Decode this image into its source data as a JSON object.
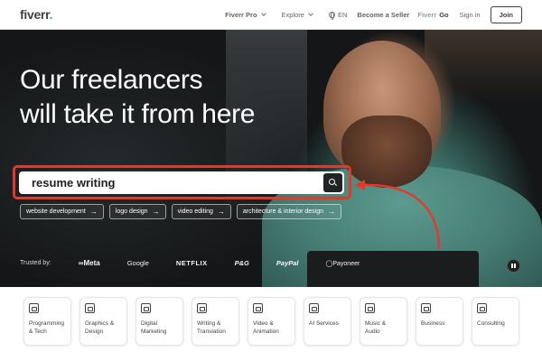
{
  "header": {
    "logo": "fiverr",
    "logo_dot": ".",
    "nav": {
      "fiverr_pro": "Fiverr Pro",
      "explore": "Explore",
      "language": "EN",
      "become_seller": "Become a Seller",
      "fiverr_go_prefix": "Fiverr",
      "fiverr_go_suffix": "Go",
      "sign_in": "Sign in",
      "join": "Join"
    }
  },
  "hero": {
    "headline_line1": "Our freelancers",
    "headline_line2": "will take it from here",
    "search": {
      "value": "resume writing",
      "icon": "search-icon"
    },
    "annotation_color": "#e03a2c",
    "chips": [
      {
        "label": "website development",
        "arrow": "→"
      },
      {
        "label": "logo design",
        "arrow": "→"
      },
      {
        "label": "video editing",
        "arrow": "→"
      },
      {
        "label": "architecture & interior design",
        "arrow": "→"
      }
    ],
    "trusted": {
      "label": "Trusted by:",
      "brands": [
        "∞Meta",
        "Google",
        "NETFLIX",
        "P&G",
        "PayPal",
        "◯Payoneer"
      ]
    },
    "pause_icon": "pause-icon"
  },
  "categories": [
    {
      "label": "Programming & Tech",
      "icon": "monitor-icon"
    },
    {
      "label": "Graphics & Design",
      "icon": "palette-icon"
    },
    {
      "label": "Digital Marketing",
      "icon": "marketing-icon"
    },
    {
      "label": "Writing & Translation",
      "icon": "translate-icon"
    },
    {
      "label": "Video & Animation",
      "icon": "video-icon"
    },
    {
      "label": "AI Services",
      "icon": "ai-icon"
    },
    {
      "label": "Music & Audio",
      "icon": "music-icon"
    },
    {
      "label": "Business",
      "icon": "business-icon"
    },
    {
      "label": "Consulting",
      "icon": "consulting-icon"
    }
  ],
  "colors": {
    "brand_green": "#1dbf73",
    "text_dark": "#404145",
    "annotation_red": "#e03a2c"
  }
}
